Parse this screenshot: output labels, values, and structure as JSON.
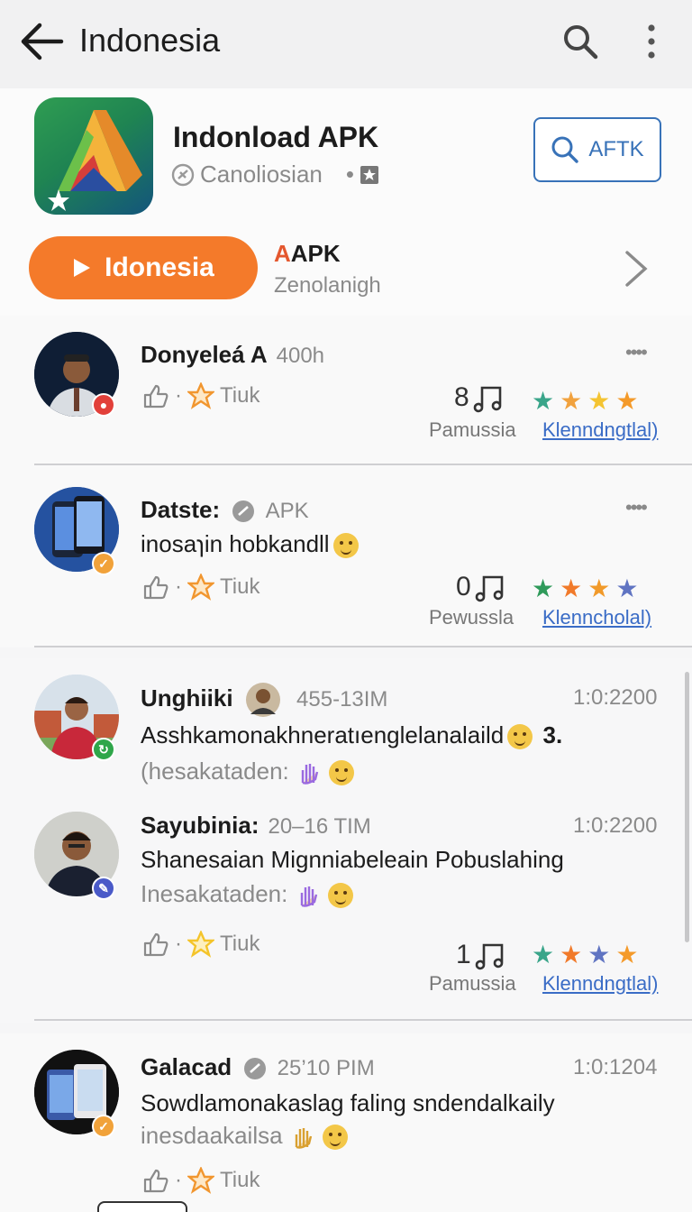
{
  "header": {
    "title": "Indonesia"
  },
  "app": {
    "name": "Indonload APK",
    "developer": "Canoliosian",
    "secondary_button": "AFTK",
    "install_label": "Idonesia",
    "apk_logo": "APK",
    "apk_logo_accent": "A",
    "apk_sub": "Zenolanigh"
  },
  "reviews": [
    {
      "name": "Donyeleá A",
      "meta": "400h",
      "like_label": "Tiuk",
      "count": "8",
      "stats_label": "Pamussia",
      "link": "Klenndngtlal)",
      "stars": [
        "#3aa58a",
        "#f1a23e",
        "#f4c432",
        "#f49a2a"
      ]
    },
    {
      "name": "Datste:",
      "meta": "APK",
      "body": "inosaɿin hobkandll",
      "like_label": "Tiuk",
      "count": "0",
      "stats_label": "Pewussla",
      "link": "Klenncholal)",
      "stars": [
        "#2f9a5a",
        "#f17a2a",
        "#f19a2a",
        "#6074c2"
      ]
    },
    {
      "name": "Unghiiki",
      "meta": "455-13IM",
      "time": "1:0:2200",
      "body": "Asshkamonakhneratıenglelanalaild",
      "body_suffix": "3.",
      "sub": "(hesakataden:"
    },
    {
      "name": "Sayubinia:",
      "meta": "20–16 TIM",
      "time": "1:0:2200",
      "body": "Shanesaian Mignniabeleain Pobuslahing",
      "sub": "Inesakataden:",
      "like_label": "Tiuk",
      "count": "1",
      "stats_label": "Pamussia",
      "link": "Klenndngtlal)",
      "stars": [
        "#3aa58a",
        "#f17a2a",
        "#6074c2",
        "#f49a2a"
      ]
    },
    {
      "name": "Galacad",
      "meta": "25’10 PIM",
      "time": "1:0:1204",
      "body": "Sowdlamonakaslag faling sndendalkaily",
      "sub": "inesdaakailsa",
      "like_label": "Tiuk"
    }
  ],
  "colors": {
    "accent_orange": "#f47a2a",
    "link_blue": "#3a6cc6",
    "outline_blue": "#3872b8"
  }
}
